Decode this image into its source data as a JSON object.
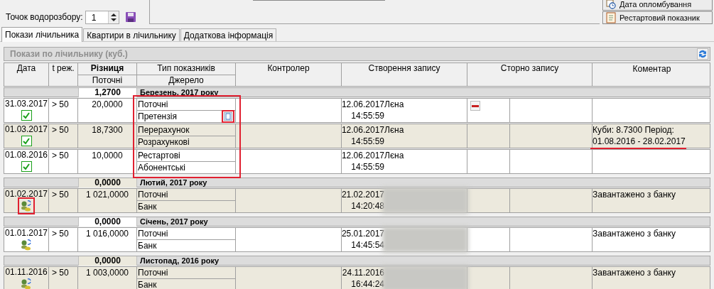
{
  "top": {
    "label": "Точок водорозбору:",
    "spin_value": "1",
    "buttons": [
      {
        "label": "Дата опломбування"
      },
      {
        "label": "Рестартовий показник"
      }
    ]
  },
  "tabs": [
    {
      "label": "Покази лічильника",
      "selected": true
    },
    {
      "label": "Квартири в лічильнику",
      "selected": false
    },
    {
      "label": "Додаткова інформація",
      "selected": false
    }
  ],
  "grid": {
    "title": "Покази по лічильнику (куб.)",
    "columns": {
      "date": "Дата",
      "mode": "t реж.",
      "diff": "Різниця",
      "diff_sub": "Поточні",
      "type": "Тип показників",
      "type_sub": "Джерело",
      "controller": "Контролер",
      "created": "Створення запису",
      "storno": "Сторно запису",
      "comment": "Коментар"
    },
    "groups": [
      {
        "total": "1,2700",
        "month": "Березень, 2017 року",
        "shaded": false,
        "highlight_types": true,
        "records": [
          {
            "date": "31.03.2017",
            "indicator": {
              "kind": "check",
              "checked": true
            },
            "mode": "> 50",
            "value": "20,0000",
            "type": "Поточні",
            "source": "Претензія",
            "note": {
              "highlighted": true
            },
            "created_date": "12.06.2017",
            "created_time": "14:55:59",
            "operator": "Лєна",
            "storno": true,
            "shaded": false
          },
          {
            "date": "01.03.2017",
            "indicator": {
              "kind": "check",
              "checked": true
            },
            "mode": "> 50",
            "value": "18,7300",
            "type": "Перерахунок",
            "source": "Розрахункові",
            "created_date": "12.06.2017",
            "created_time": "14:55:59",
            "operator": "Лєна",
            "storno": false,
            "comment": {
              "text": "Куби: 8.7300 Період: 01.08.2016 - 28.02.2017",
              "underlined": true
            },
            "shaded": true
          },
          {
            "date": "01.08.2016",
            "indicator": {
              "kind": "check",
              "checked": true
            },
            "mode": "> 50",
            "value": "10,0000",
            "type": "Рестартові",
            "source": "Абонентські",
            "created_date": "12.06.2017",
            "created_time": "14:55:59",
            "operator": "Лєна",
            "storno": false,
            "shaded": false
          }
        ]
      },
      {
        "total": "0,0000",
        "month": "Лютий, 2017 року",
        "shaded": true,
        "highlight_types": false,
        "records": [
          {
            "date": "01.02.2017",
            "indicator": {
              "kind": "bank",
              "highlighted": true
            },
            "mode": "> 50",
            "value": "1 021,0000",
            "type": "Поточні",
            "source": "Банк",
            "created_date": "21.02.2017",
            "created_time": "14:20:48",
            "storno": false,
            "comment": {
              "text": "Завантажено з банку",
              "underlined": false
            },
            "shaded": true
          }
        ]
      },
      {
        "total": "0,0000",
        "month": "Січень, 2017 року",
        "shaded": false,
        "highlight_types": false,
        "records": [
          {
            "date": "01.01.2017",
            "indicator": {
              "kind": "bank",
              "highlighted": false
            },
            "mode": "> 50",
            "value": "1 016,0000",
            "type": "Поточні",
            "source": "Банк",
            "created_date": "25.01.2017",
            "created_time": "14:45:54",
            "storno": false,
            "comment": {
              "text": "Завантажено з банку",
              "underlined": false
            },
            "shaded": false
          }
        ]
      },
      {
        "total": "0,0000",
        "month": "Листопад, 2016 року",
        "shaded": true,
        "highlight_types": false,
        "records": [
          {
            "date": "01.11.2016",
            "indicator": {
              "kind": "bank",
              "highlighted": false
            },
            "mode": "> 50",
            "value": "1 003,0000",
            "type": "Поточні",
            "source": "Банк",
            "created_date": "24.11.2016",
            "created_time": "16:44:24",
            "storno": false,
            "comment": {
              "text": "Завантажено з банку",
              "underlined": false
            },
            "shaded": true
          }
        ]
      }
    ]
  }
}
